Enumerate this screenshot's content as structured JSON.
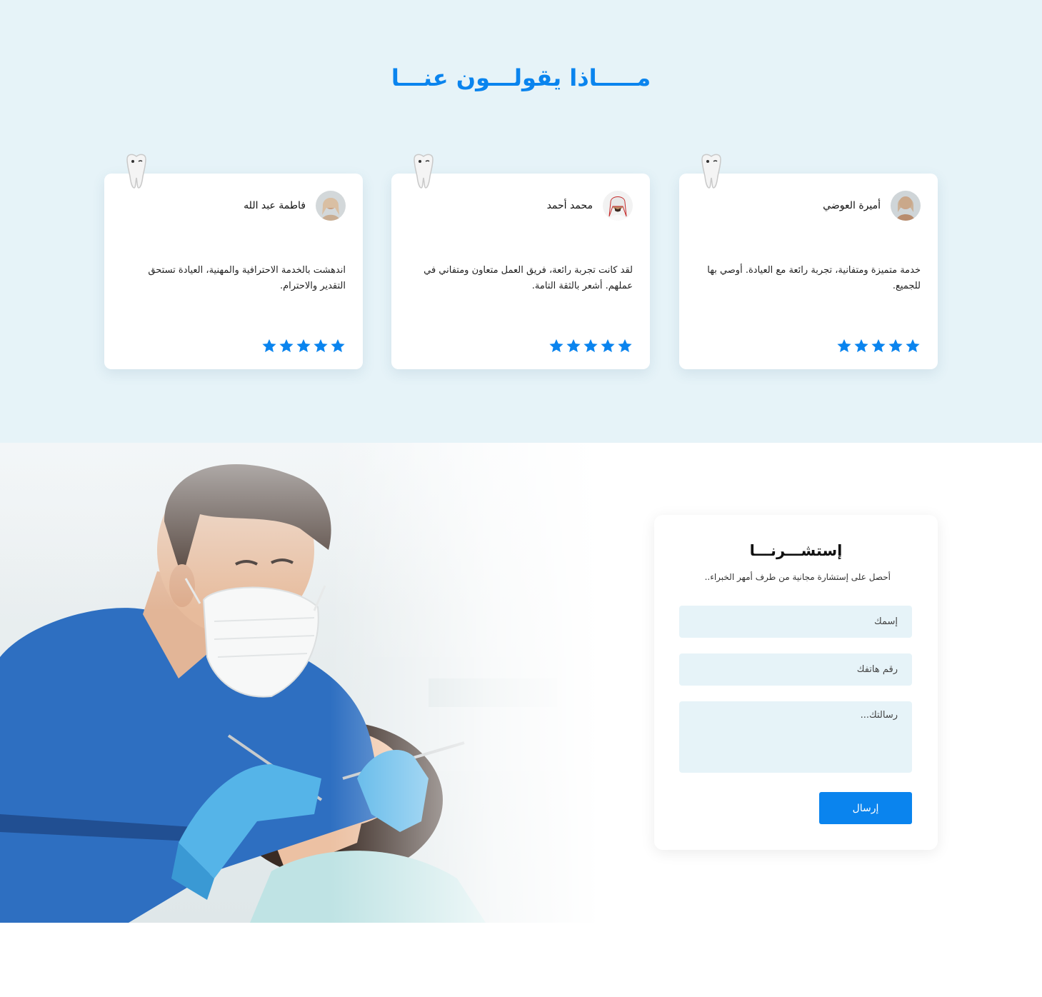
{
  "testimonials": {
    "title": "مـــــاذا يقولـــون عنـــا",
    "cards": [
      {
        "name": "أميرة العوضي",
        "quote": "خدمة متميزة ومتفانية، تجربة رائعة مع العيادة. أوصي بها للجميع.",
        "rating": 5
      },
      {
        "name": "محمد أحمد",
        "quote": "لقد كانت تجربة رائعة، فريق العمل متعاون ومتفاني في عملهم. أشعر بالثقة التامة.",
        "rating": 5
      },
      {
        "name": "فاطمة عبد الله",
        "quote": "اندهشت بالخدمة الاحترافية والمهنية، العيادة تستحق التقدير والاحترام.",
        "rating": 5
      }
    ]
  },
  "consult": {
    "title": "إستشـــرنـــا",
    "subtitle": "أحصل على إستشارة مجانية من طرف أمهر الخبراء..",
    "name_placeholder": "إسمك",
    "phone_placeholder": "رقم هاتفك",
    "message_placeholder": "رسالتك...",
    "submit_label": "إرسال"
  },
  "colors": {
    "accent": "#0a84ee",
    "section_bg": "#e6f3f8",
    "star": "#0a84ee"
  }
}
